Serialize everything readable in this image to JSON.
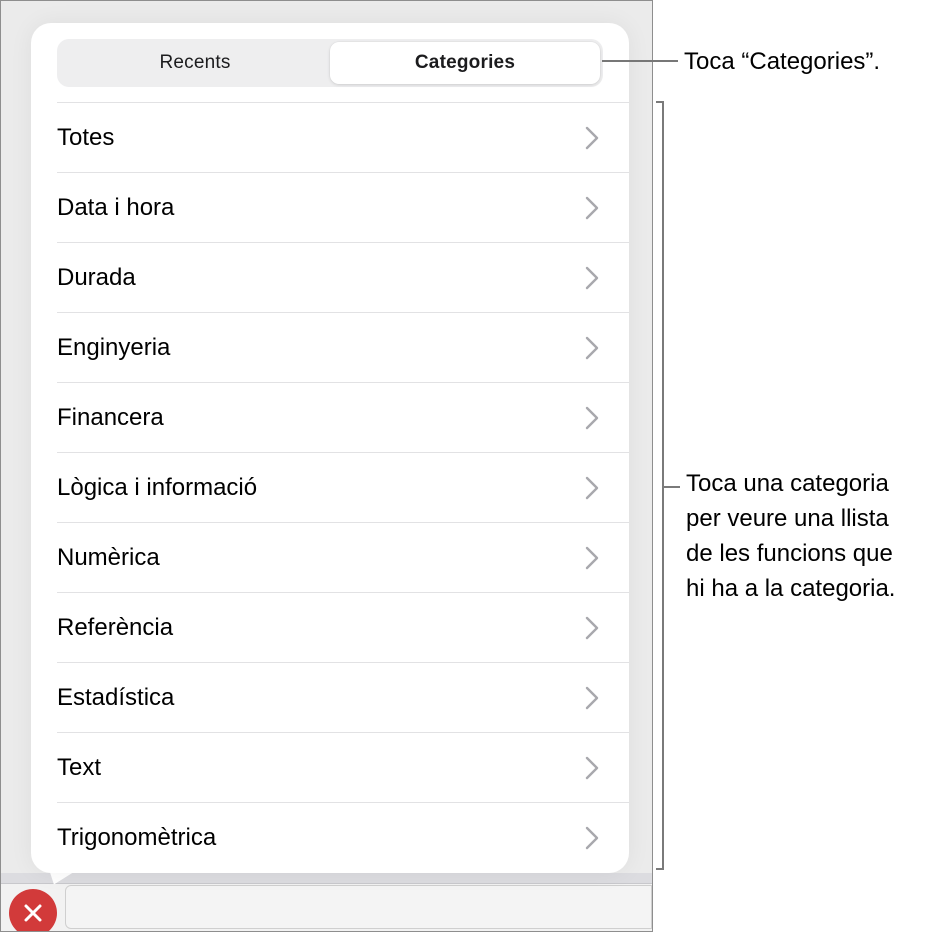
{
  "segmented_control": {
    "tabs": [
      {
        "label": "Recents",
        "selected": false
      },
      {
        "label": "Categories",
        "selected": true
      }
    ]
  },
  "categories": [
    {
      "label": "Totes"
    },
    {
      "label": "Data i hora"
    },
    {
      "label": "Durada"
    },
    {
      "label": "Enginyeria"
    },
    {
      "label": "Financera"
    },
    {
      "label": "Lògica i informació"
    },
    {
      "label": "Numèrica"
    },
    {
      "label": "Referència"
    },
    {
      "label": "Estadística"
    },
    {
      "label": "Text"
    },
    {
      "label": "Trigonomètrica"
    }
  ],
  "formula_bar": {
    "cancel_icon": "x-icon",
    "cancel_color": "#d23a3a",
    "input_value": ""
  },
  "callouts": {
    "tap_categories": "Toca “Categories”.",
    "tap_category": [
      "Toca una categoria",
      "per veure una llista",
      "de les funcions que",
      "hi ha a la categoria."
    ]
  },
  "icons": {
    "row_chevron": "chevron-right-icon"
  }
}
